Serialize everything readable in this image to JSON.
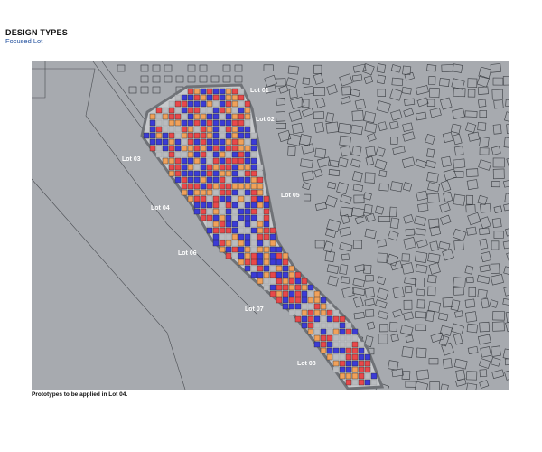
{
  "header": {
    "title": "DESIGN TYPES",
    "subtitle": "Focused Lot"
  },
  "caption": "Prototypes to be applied in Lot 04.",
  "map": {
    "lots": [
      "Lot 01",
      "Lot 02",
      "Lot 03",
      "Lot 04",
      "Lot 05",
      "Lot 06",
      "Lot 07",
      "Lot 08"
    ],
    "colors": {
      "background": "#a7aaaf",
      "context_building_outline": "#3a3d42",
      "site_fill": "#c7c9cc",
      "site_outline": "#6f7277",
      "prototype_blue": "#3b3bd6",
      "prototype_red": "#e8484a",
      "prototype_orange": "#f0a15a",
      "shared_space": "#b9bbbf"
    }
  }
}
